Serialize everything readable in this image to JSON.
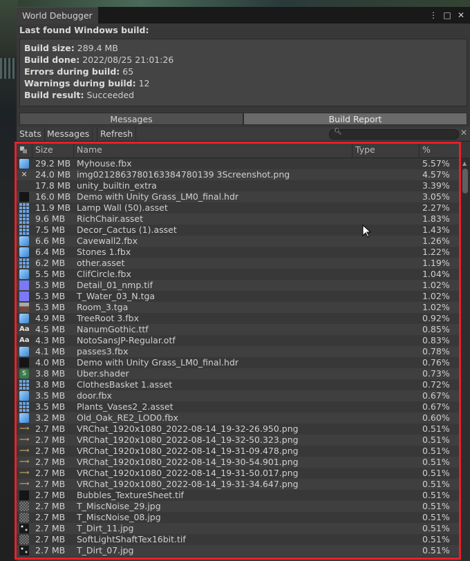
{
  "window": {
    "title": "World Debugger",
    "controls": [
      "⋮",
      "□",
      "✕"
    ]
  },
  "build": {
    "section_title": "Last found Windows build:",
    "fields": [
      {
        "label": "Build size:",
        "value": "289.4 MB"
      },
      {
        "label": "Build done:",
        "value": "2022/08/25 21:01:26"
      },
      {
        "label": "Errors during build:",
        "value": "65"
      },
      {
        "label": "Warnings during build:",
        "value": "12"
      },
      {
        "label": "Build result:",
        "value": "Succeeded"
      }
    ]
  },
  "view_toggle": {
    "messages_label": "Messages",
    "build_report_label": "Build Report",
    "selected": "Build Report"
  },
  "toolbar": {
    "stats_label": "Stats",
    "messages_label": "Messages",
    "refresh_label": "Refresh",
    "search_placeholder": ""
  },
  "table": {
    "columns": [
      "Size",
      "Name",
      "Type",
      "%"
    ],
    "rows": [
      {
        "icon": "mesh-icon",
        "size": "29.2 MB",
        "name": "Myhouse.fbx",
        "type": "",
        "pct": "5.57%"
      },
      {
        "icon": "sparkle-icon",
        "size": "24.0 MB",
        "name": "img0212863780163384780139 3Screenshot.png",
        "type": "",
        "pct": "4.57%"
      },
      {
        "icon": "none",
        "size": "17.8 MB",
        "name": "unity_builtin_extra",
        "type": "",
        "pct": "3.39%"
      },
      {
        "icon": "dark-texture-icon",
        "size": "16.0 MB",
        "name": "Demo with Unity Grass_LM0_final.hdr",
        "type": "",
        "pct": "3.05%"
      },
      {
        "icon": "asset-icon",
        "size": "11.9 MB",
        "name": "Lamp Wall (50).asset",
        "type": "",
        "pct": "2.27%"
      },
      {
        "icon": "asset-icon",
        "size": "9.6 MB",
        "name": "RichChair.asset",
        "type": "",
        "pct": "1.83%"
      },
      {
        "icon": "asset-icon",
        "size": "7.5 MB",
        "name": "Decor_Cactus (1).asset",
        "type": "",
        "pct": "1.43%"
      },
      {
        "icon": "mesh-icon",
        "size": "6.6 MB",
        "name": "Cavewall2.fbx",
        "type": "",
        "pct": "1.26%"
      },
      {
        "icon": "mesh-icon",
        "size": "6.4 MB",
        "name": "Stones 1.fbx",
        "type": "",
        "pct": "1.22%"
      },
      {
        "icon": "asset-icon",
        "size": "6.2 MB",
        "name": "other.asset",
        "type": "",
        "pct": "1.19%"
      },
      {
        "icon": "mesh-icon",
        "size": "5.5 MB",
        "name": "ClifCircle.fbx",
        "type": "",
        "pct": "1.04%"
      },
      {
        "icon": "texture-icon",
        "size": "5.3 MB",
        "name": "Detail_01_nmp.tif",
        "type": "",
        "pct": "1.02%"
      },
      {
        "icon": "texture-icon",
        "size": "5.3 MB",
        "name": "T_Water_03_N.tga",
        "type": "",
        "pct": "1.02%"
      },
      {
        "icon": "room-icon",
        "size": "5.3 MB",
        "name": "Room_3.tga",
        "type": "",
        "pct": "1.02%"
      },
      {
        "icon": "mesh-icon",
        "size": "4.9 MB",
        "name": "TreeRoot 3.fbx",
        "type": "",
        "pct": "0.92%"
      },
      {
        "icon": "font-icon",
        "size": "4.5 MB",
        "name": "NanumGothic.ttf",
        "type": "",
        "pct": "0.85%"
      },
      {
        "icon": "font-icon",
        "size": "4.3 MB",
        "name": "NotoSansJP-Regular.otf",
        "type": "",
        "pct": "0.83%"
      },
      {
        "icon": "mesh-icon",
        "size": "4.1 MB",
        "name": "passes3.fbx",
        "type": "",
        "pct": "0.78%"
      },
      {
        "icon": "dark-texture-icon",
        "size": "4.0 MB",
        "name": "Demo with Unity Grass_LM0_final.hdr",
        "type": "",
        "pct": "0.76%"
      },
      {
        "icon": "shader-icon",
        "size": "3.8 MB",
        "name": "Uber.shader",
        "type": "",
        "pct": "0.73%"
      },
      {
        "icon": "asset-icon",
        "size": "3.8 MB",
        "name": "ClothesBasket 1.asset",
        "type": "",
        "pct": "0.72%"
      },
      {
        "icon": "mesh-icon",
        "size": "3.5 MB",
        "name": "door.fbx",
        "type": "",
        "pct": "0.67%"
      },
      {
        "icon": "asset-icon",
        "size": "3.5 MB",
        "name": "Plants_Vases2_2.asset",
        "type": "",
        "pct": "0.67%"
      },
      {
        "icon": "mesh-icon",
        "size": "3.2 MB",
        "name": "Old_Oak_RE2_LOD0.fbx",
        "type": "",
        "pct": "0.60%"
      },
      {
        "icon": "png-icon",
        "size": "2.7 MB",
        "name": "VRChat_1920x1080_2022-08-14_19-32-26.950.png",
        "type": "",
        "pct": "0.51%"
      },
      {
        "icon": "png-icon",
        "size": "2.7 MB",
        "name": "VRChat_1920x1080_2022-08-14_19-32-50.323.png",
        "type": "",
        "pct": "0.51%"
      },
      {
        "icon": "png-icon",
        "size": "2.7 MB",
        "name": "VRChat_1920x1080_2022-08-14_19-31-09.478.png",
        "type": "",
        "pct": "0.51%"
      },
      {
        "icon": "png-icon",
        "size": "2.7 MB",
        "name": "VRChat_1920x1080_2022-08-14_19-30-54.901.png",
        "type": "",
        "pct": "0.51%"
      },
      {
        "icon": "png-icon",
        "size": "2.7 MB",
        "name": "VRChat_1920x1080_2022-08-14_19-31-50.017.png",
        "type": "",
        "pct": "0.51%"
      },
      {
        "icon": "png-icon",
        "size": "2.7 MB",
        "name": "VRChat_1920x1080_2022-08-14_19-31-34.647.png",
        "type": "",
        "pct": "0.51%"
      },
      {
        "icon": "dark-texture-icon",
        "size": "2.7 MB",
        "name": "Bubbles_TextureSheet.tif",
        "type": "",
        "pct": "0.51%"
      },
      {
        "icon": "noise-icon",
        "size": "2.7 MB",
        "name": "T_MiscNoise_29.jpg",
        "type": "",
        "pct": "0.51%"
      },
      {
        "icon": "noise-icon",
        "size": "2.7 MB",
        "name": "T_MiscNoise_08.jpg",
        "type": "",
        "pct": "0.51%"
      },
      {
        "icon": "dirt-icon",
        "size": "2.7 MB",
        "name": "T_Dirt_11.jpg",
        "type": "",
        "pct": "0.51%"
      },
      {
        "icon": "noise-icon",
        "size": "2.7 MB",
        "name": "SoftLightShaftTex16bit.tif",
        "type": "",
        "pct": "0.51%"
      },
      {
        "icon": "dirt-icon",
        "size": "2.7 MB",
        "name": "T_Dirt_07.jpg",
        "type": "",
        "pct": "0.51%"
      }
    ]
  },
  "colors": {
    "highlight": "#e8202a",
    "panel": "#383838"
  }
}
